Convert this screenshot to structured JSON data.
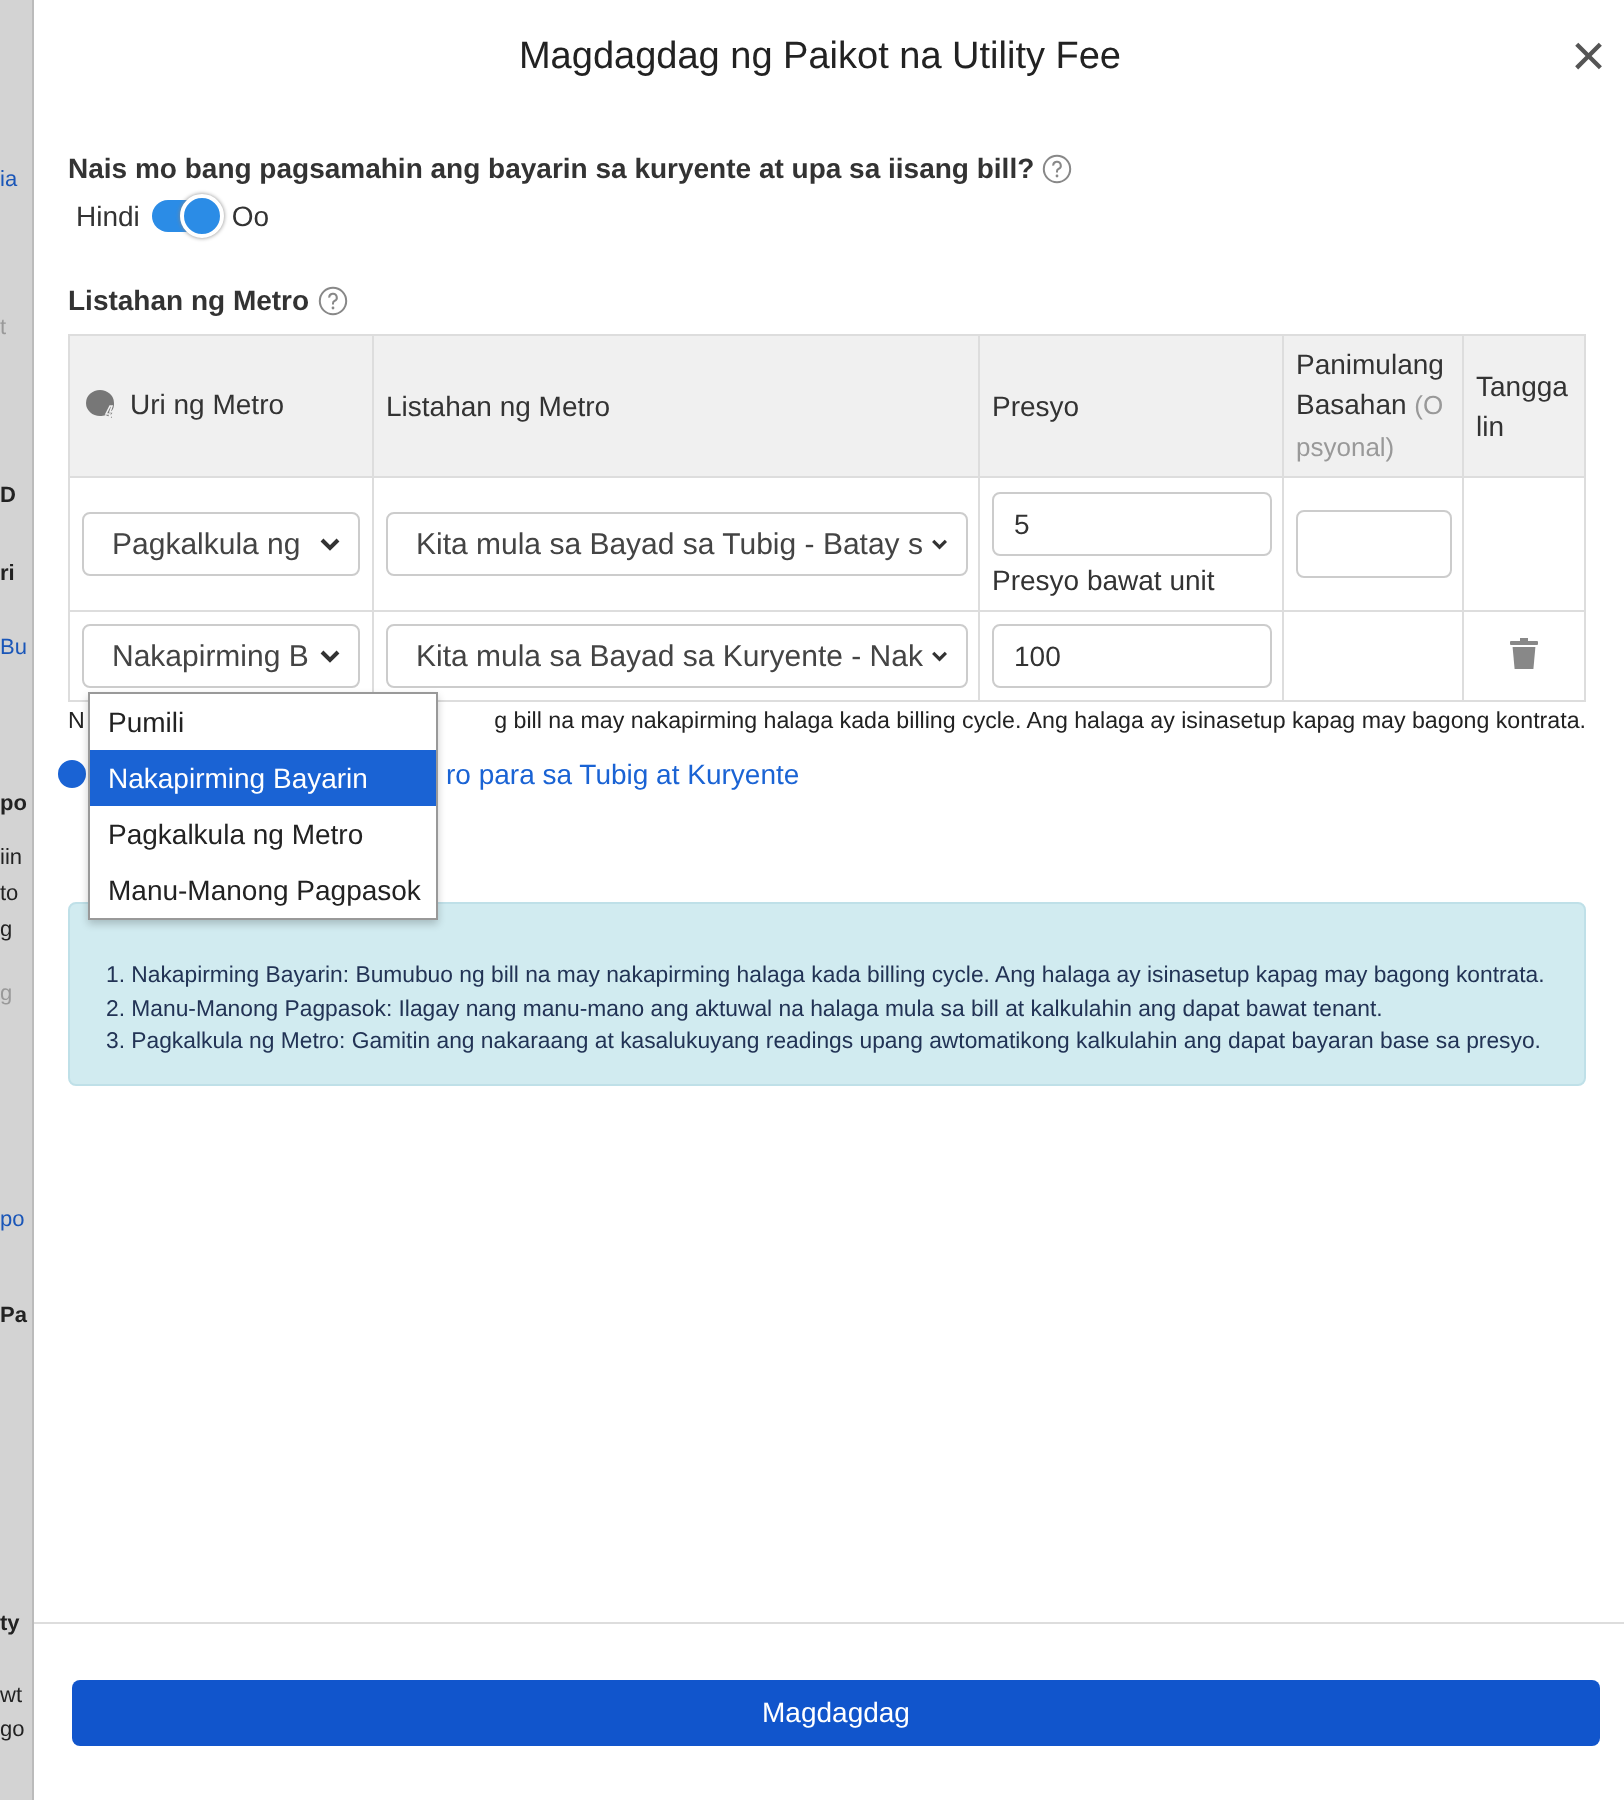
{
  "background_fragments": [
    {
      "text": "ia",
      "kind": "link"
    },
    {
      "text": "t",
      "kind": "muted"
    },
    {
      "text": "D",
      "kind": "bold"
    },
    {
      "text": "ri",
      "kind": "bold"
    },
    {
      "text": "Bu",
      "kind": "link"
    },
    {
      "text": "po",
      "kind": "bold"
    },
    {
      "text": "iin",
      "kind": "plain"
    },
    {
      "text": "to",
      "kind": "plain"
    },
    {
      "text": "g",
      "kind": "plain"
    },
    {
      "text": "g",
      "kind": "muted"
    },
    {
      "text": "po",
      "kind": "link"
    },
    {
      "text": "Pa",
      "kind": "bold"
    },
    {
      "text": "ty",
      "kind": "bold"
    },
    {
      "text": "wt",
      "kind": "plain"
    },
    {
      "text": "go",
      "kind": "plain"
    }
  ],
  "modal": {
    "title": "Magdagdag ng Paikot na Utility Fee",
    "close": "×"
  },
  "combine": {
    "question": "Nais mo bang pagsamahin ang bayarin sa kuryente at upa sa iisang bill?",
    "off_label": "Hindi",
    "on_label": "Oo",
    "on": true
  },
  "meters": {
    "title": "Listahan ng Metro",
    "columns": [
      {
        "label": "Uri ng Metro"
      },
      {
        "label": "Listahan ng Metro"
      },
      {
        "label": "Presyo"
      },
      {
        "label": "Panimulang Basahan",
        "note": "(Opsyonal)"
      },
      {
        "label": "Tanggalin"
      }
    ],
    "rows": [
      {
        "type": "Pagkalkula ng",
        "meter": "Kita mula sa Bayad sa Tubig - Batay s",
        "price": "5",
        "price_hint": "Presyo bawat unit",
        "reading_field": true,
        "removable": false
      },
      {
        "type": "Nakapirming B",
        "meter": "Kita mula sa Bayad sa Kuryente - Nak",
        "price": "100",
        "price_hint": null,
        "reading_field": false,
        "removable": true
      }
    ],
    "dropdown": {
      "open": true,
      "options": [
        {
          "label": "Pumili",
          "selected": false
        },
        {
          "label": "Nakapirming Bayarin",
          "selected": true
        },
        {
          "label": "Pagkalkula ng Metro",
          "selected": false
        },
        {
          "label": "Manu-Manong Pagpasok",
          "selected": false
        }
      ]
    },
    "hint_start": "N",
    "hint_end": "g bill na may nakapirming halaga kada billing cycle. Ang halaga ay isinasetup kapag may bagong kontrata.",
    "add_link": "ro para sa Tubig at Kuryente"
  },
  "info": {
    "items": [
      "1. Nakapirming Bayarin: Bumubuo ng bill na may nakapirming halaga kada billing cycle. Ang halaga ay isinasetup kapag may bagong kontrata.",
      "2. Manu-Manong Pagpasok: Ilagay nang manu-mano ang aktuwal na halaga mula sa bill at kalkulahin ang dapat bawat tenant.",
      "3. Pagkalkula ng Metro: Gamitin ang nakaraang at kasalukuyang readings upang awtomatikong kalkulahin ang dapat bayaran base sa presyo."
    ]
  },
  "submit": "Magdagdag"
}
